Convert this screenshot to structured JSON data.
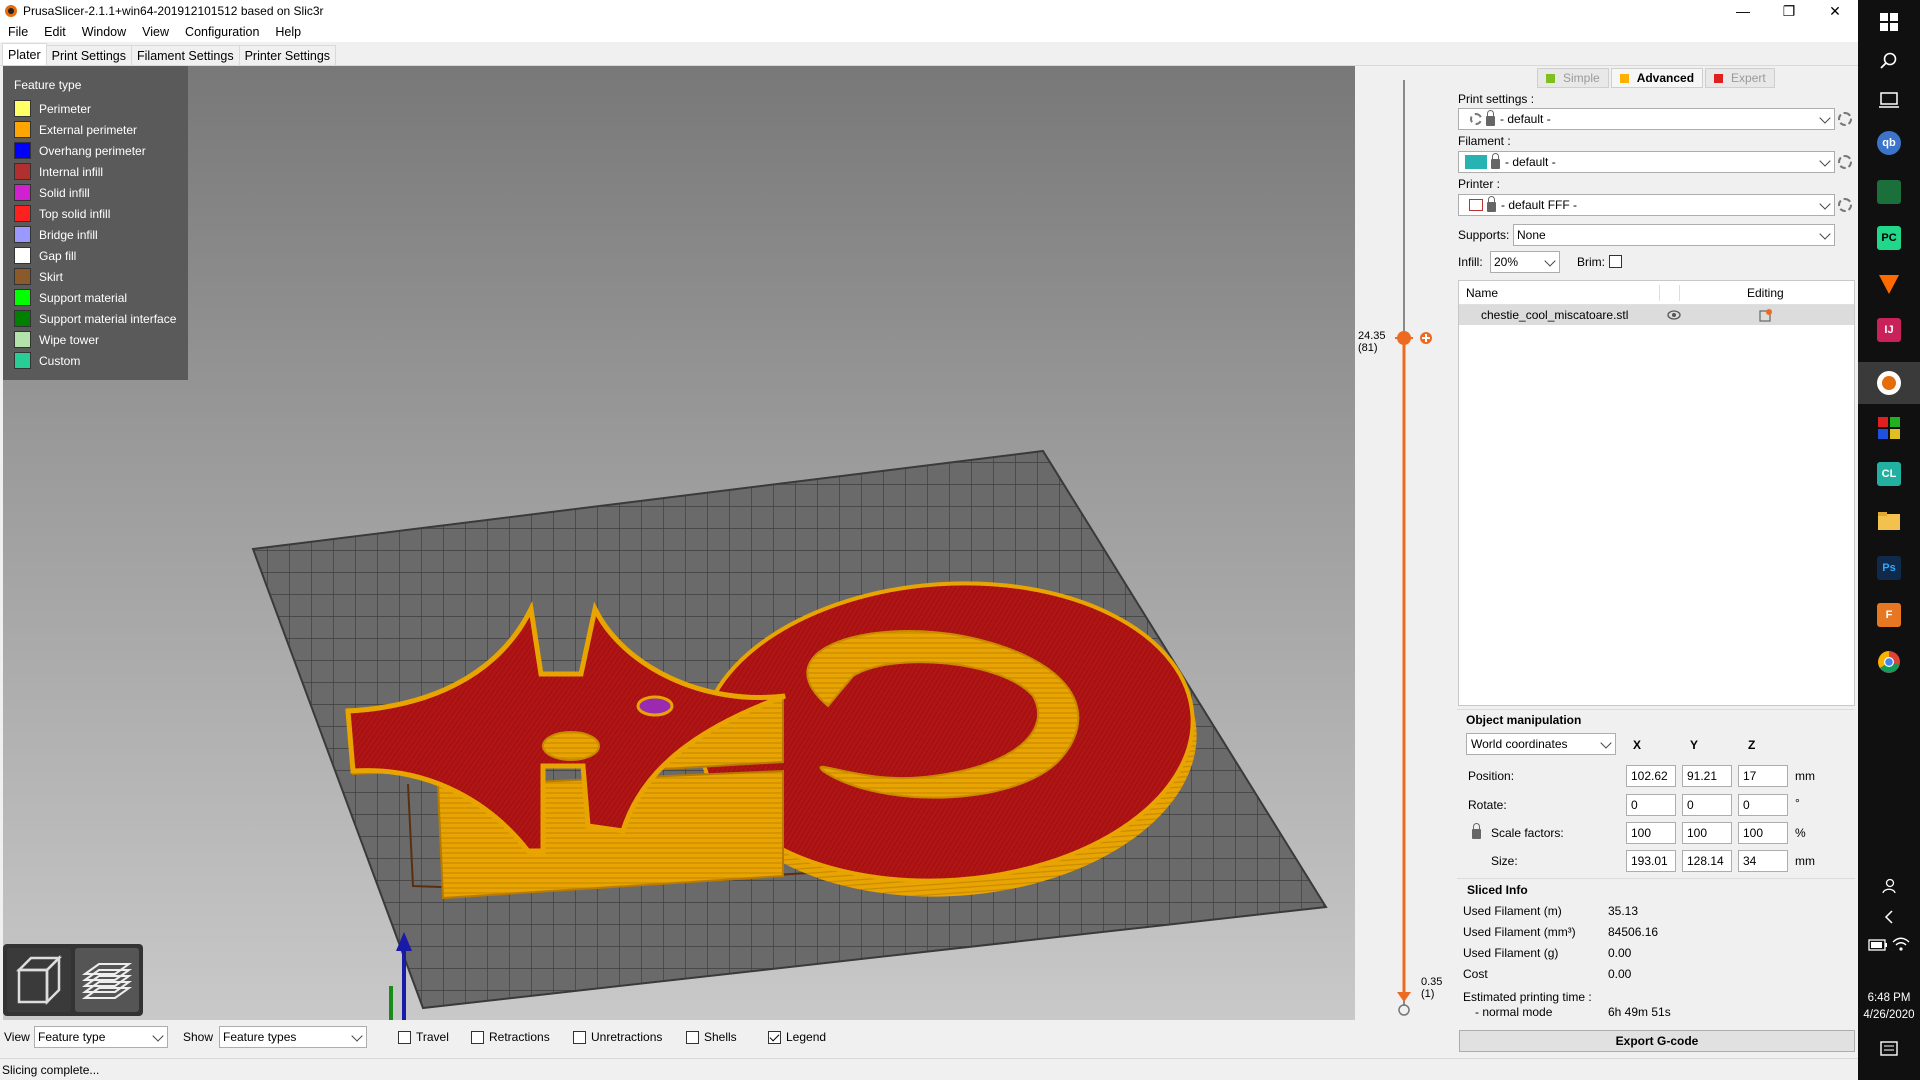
{
  "window": {
    "title": "PrusaSlicer-2.1.1+win64-201912101512 based on Slic3r",
    "minimize_glyph": "—",
    "restore_glyph": "❐",
    "close_glyph": "✕"
  },
  "menu": [
    "File",
    "Edit",
    "Window",
    "View",
    "Configuration",
    "Help"
  ],
  "tabs": [
    "Plater",
    "Print Settings",
    "Filament Settings",
    "Printer Settings"
  ],
  "legend": {
    "title": "Feature type",
    "items": [
      {
        "label": "Perimeter",
        "color": "#ffff66"
      },
      {
        "label": "External perimeter",
        "color": "#ffa500"
      },
      {
        "label": "Overhang perimeter",
        "color": "#0000ff"
      },
      {
        "label": "Internal infill",
        "color": "#b03030"
      },
      {
        "label": "Solid infill",
        "color": "#d020d0"
      },
      {
        "label": "Top solid infill",
        "color": "#ff2020"
      },
      {
        "label": "Bridge infill",
        "color": "#9999ff"
      },
      {
        "label": "Gap fill",
        "color": "#ffffff"
      },
      {
        "label": "Skirt",
        "color": "#8b5a2b"
      },
      {
        "label": "Support material",
        "color": "#00ff00"
      },
      {
        "label": "Support material interface",
        "color": "#008000"
      },
      {
        "label": "Wipe tower",
        "color": "#b3e3ab"
      },
      {
        "label": "Custom",
        "color": "#28cc94"
      }
    ]
  },
  "layer_slider": {
    "upper_value": "24.35",
    "upper_layer": "(81)",
    "lower_value": "0.35",
    "lower_layer": "(1)",
    "accent": "#ed6b21"
  },
  "mode": {
    "simple": "Simple",
    "advanced": "Advanced",
    "expert": "Expert",
    "simple_color": "#7fbf1f",
    "advanced_color": "#ffb000",
    "expert_color": "#e02020"
  },
  "settings": {
    "print_label": "Print settings :",
    "print_value": "- default -",
    "filament_label": "Filament :",
    "filament_value": "- default -",
    "filament_color": "#29b2b2",
    "printer_label": "Printer :",
    "printer_value": "- default FFF -",
    "supports_label": "Supports:",
    "supports_value": "None",
    "infill_label": "Infill:",
    "infill_value": "20%",
    "brim_label": "Brim:"
  },
  "object_list": {
    "col_name": "Name",
    "col_editing": "Editing",
    "rows": [
      {
        "name": "chestie_cool_miscatoare.stl"
      }
    ]
  },
  "manipulation": {
    "title": "Object manipulation",
    "coords": "World coordinates",
    "x": "X",
    "y": "Y",
    "z": "Z",
    "position_label": "Position:",
    "position": [
      "102.62",
      "91.21",
      "17"
    ],
    "position_unit": "mm",
    "rotate_label": "Rotate:",
    "rotate": [
      "0",
      "0",
      "0"
    ],
    "rotate_unit": "°",
    "scale_label": "Scale factors:",
    "scale": [
      "100",
      "100",
      "100"
    ],
    "scale_unit": "%",
    "size_label": "Size:",
    "size": [
      "193.01",
      "128.14",
      "34"
    ],
    "size_unit": "mm"
  },
  "sliced_info": {
    "title": "Sliced Info",
    "rows": [
      {
        "label": "Used Filament (m)",
        "value": "35.13"
      },
      {
        "label": "Used Filament (mm³)",
        "value": "84506.16"
      },
      {
        "label": "Used Filament (g)",
        "value": "0.00"
      },
      {
        "label": "Cost",
        "value": "0.00"
      }
    ],
    "time_label": "Estimated printing time :",
    "mode_label": "- normal mode",
    "time_value": "6h 49m 51s"
  },
  "export_label": "Export G-code",
  "bottom": {
    "view_label": "View",
    "view_value": "Feature type",
    "show_label": "Show",
    "show_value": "Feature types",
    "checks": [
      {
        "label": "Travel",
        "checked": false
      },
      {
        "label": "Retractions",
        "checked": false
      },
      {
        "label": "Unretractions",
        "checked": false
      },
      {
        "label": "Shells",
        "checked": false
      },
      {
        "label": "Legend",
        "checked": true
      }
    ]
  },
  "status": "Slicing complete...",
  "taskbar": {
    "time": "6:48 PM",
    "date": "4/26/2020",
    "apps": [
      {
        "name": "qbittorrent",
        "text": "qb",
        "color": "#3b74c8"
      },
      {
        "name": "pycharm",
        "text": "PC",
        "color": "#21d789"
      },
      {
        "name": "intellij",
        "text": "IJ",
        "color": "#c9225b"
      },
      {
        "name": "clion",
        "text": "CL",
        "color": "#22b1a0"
      },
      {
        "name": "photoshop",
        "text": "Ps",
        "color": "#0f2a4a"
      },
      {
        "name": "app-f",
        "text": "F",
        "color": "#e87722"
      }
    ]
  }
}
